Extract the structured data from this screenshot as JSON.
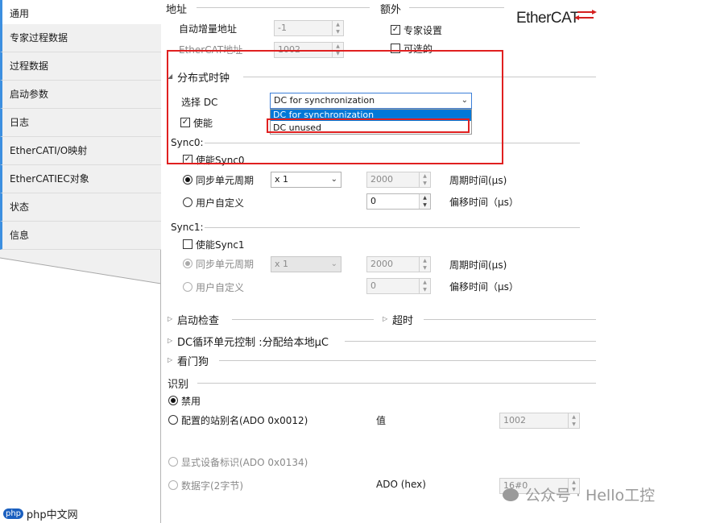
{
  "nav": {
    "items": [
      {
        "label": "通用"
      },
      {
        "label": "专家过程数据"
      },
      {
        "label": "过程数据"
      },
      {
        "label": "启动参数"
      },
      {
        "label": "日志"
      },
      {
        "label": "EtherCATI/O映射"
      },
      {
        "label": "EtherCATIEC对象"
      },
      {
        "label": "状态"
      },
      {
        "label": "信息"
      }
    ]
  },
  "address": {
    "title": "地址",
    "auto_inc_label": "自动增量地址",
    "auto_inc_value": "-1",
    "ethercat_addr_label": "EtherCAT地址",
    "ethercat_addr_value": "1002"
  },
  "extra": {
    "title": "额外",
    "expert_label": "专家设置",
    "expert_checked": true,
    "optional_label": "可选的",
    "optional_checked": false
  },
  "logo": {
    "text": "EtherCAT"
  },
  "dc": {
    "title": "分布式时钟",
    "select_label": "选择 DC",
    "select_value": "DC for synchronization",
    "dropdown_options": [
      "DC for synchronization",
      "DC unused"
    ],
    "enable_label": "使能",
    "enable_checked": true
  },
  "sync0": {
    "title": "Sync0:",
    "enable_label": "使能Sync0",
    "enable_checked": true,
    "sync_unit_label": "同步单元周期",
    "multiplier": "x 1",
    "cycle_value": "2000",
    "cycle_unit": "周期时间(μs)",
    "user_defined_label": "用户自定义",
    "offset_value": "0",
    "offset_unit": "偏移时间（μs）"
  },
  "sync1": {
    "title": "Sync1:",
    "enable_label": "使能Sync1",
    "enable_checked": false,
    "sync_unit_label": "同步单元周期",
    "multiplier": "x 1",
    "cycle_value": "2000",
    "cycle_unit": "周期时间(μs)",
    "user_defined_label": "用户自定义",
    "offset_value": "0",
    "offset_unit": "偏移时间（μs）"
  },
  "sections": {
    "startup_check": "启动检查",
    "timeout": "超时",
    "dc_cycle": "DC循环单元控制 :分配给本地μC",
    "watchdog": "看门狗"
  },
  "identify": {
    "title": "识别",
    "disable_label": "禁用",
    "alias_label": "配置的站别名(ADO 0x0012)",
    "value_label": "值",
    "alias_value": "1002",
    "explicit_label": "显式设备标识(ADO 0x0134)",
    "dataword_label": "数据字(2字节)",
    "ado_hex_label": "ADO (hex)",
    "ado_hex_value": "16#0"
  },
  "watermark": {
    "left": "php中文网",
    "right": "公众号 · Hello工控"
  }
}
